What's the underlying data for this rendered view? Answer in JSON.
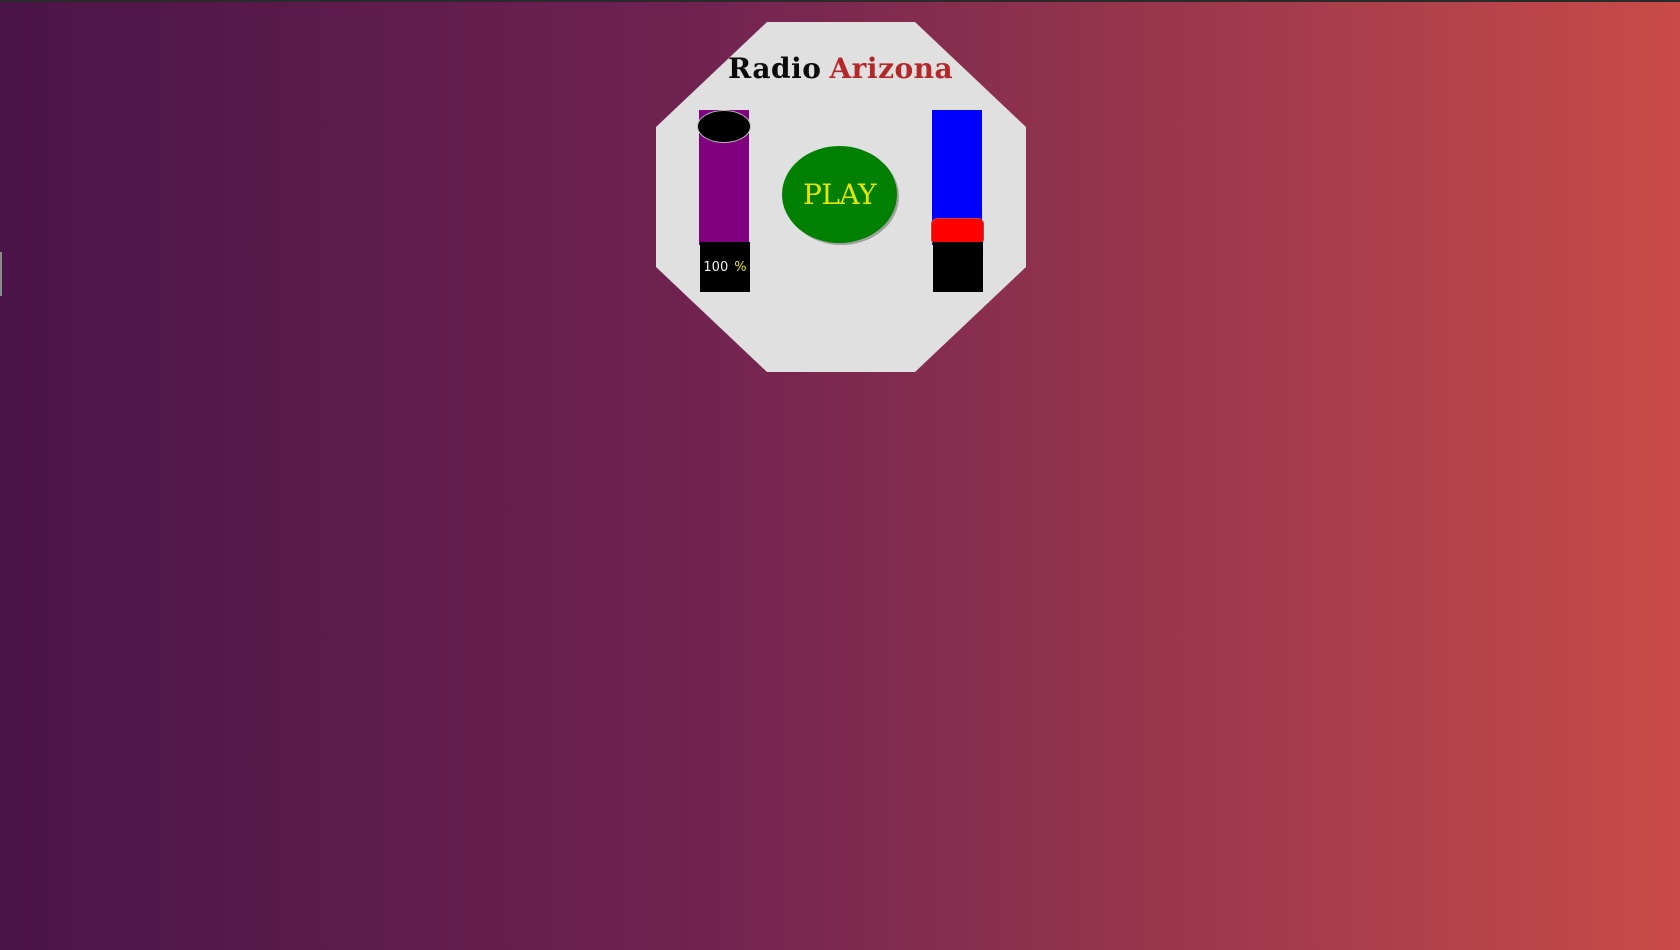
{
  "app": {
    "title_part1": "Radio",
    "title_part2": "Arizona"
  },
  "colors": {
    "background_start": "#4a1448",
    "background_end": "#c94b48",
    "panel": "#e0e0e0",
    "volume_track": "#800080",
    "volume_knob": "#000000",
    "play_button": "#008000",
    "play_label": "#e6e600",
    "tuner_track": "#0000ff",
    "tuner_knob": "#ff0000"
  },
  "volume": {
    "value": "100",
    "unit": "%",
    "level": 1.0
  },
  "player": {
    "play_label": "PLAY"
  },
  "tuner": {
    "display": ""
  }
}
